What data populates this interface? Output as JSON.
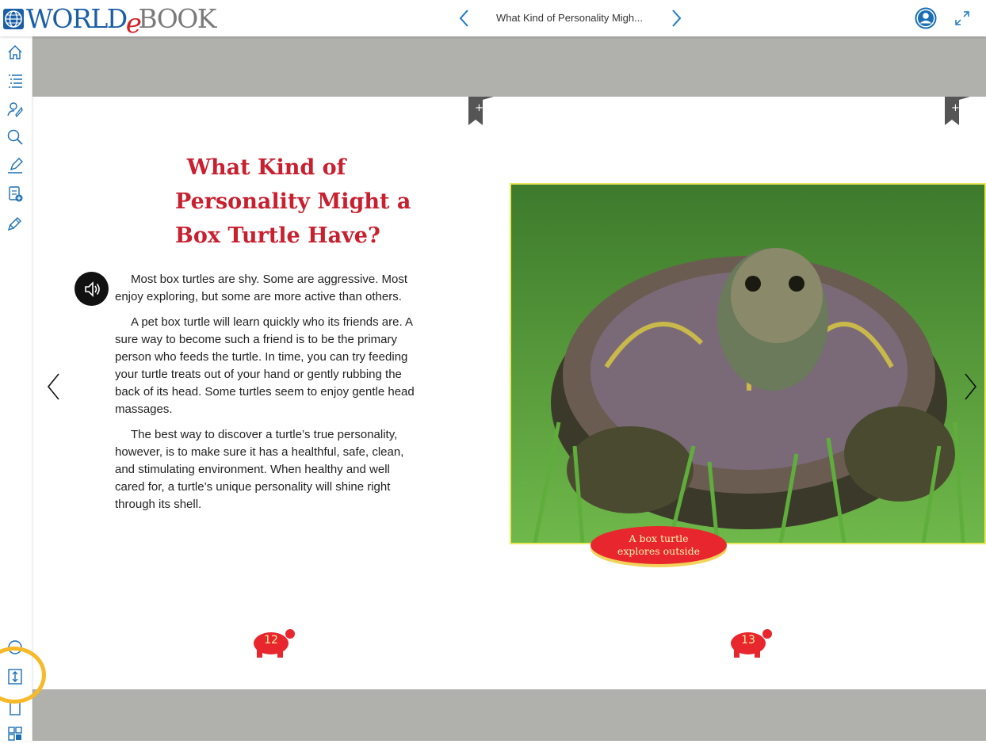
{
  "app": {
    "logo_world": "WORLD",
    "logo_e": "e",
    "logo_book": "BOOK"
  },
  "header": {
    "doc_title": "What Kind of Personality Migh..."
  },
  "page": {
    "title_lines": [
      "What Kind of",
      "Personality Might a",
      "Box Turtle Have?"
    ],
    "paragraphs": [
      "Most box turtles are shy. Some are aggressive. Most enjoy exploring, but some are more active than others.",
      "A pet box turtle will learn quickly who its friends are. A sure way to become such a friend is to be the primary person who feeds the turtle. In time, you can try feeding your turtle treats out of your hand or gently rubbing the back of its head. Some turtles seem to enjoy gentle head massages.",
      "The best way to discover a turtle’s true personality, however, is to make sure it has a healthful, safe, clean, and stimulating environment. When healthy and well cared for, a turtle’s unique personality will shine right through its shell."
    ],
    "caption_lines": [
      "A box turtle",
      "explores outside"
    ],
    "left_page_number": "12",
    "right_page_number": "13"
  },
  "sidebar": {
    "top_icons": [
      "home-icon",
      "table-of-contents-icon",
      "activities-icon",
      "search-icon",
      "notes-edit-icon",
      "add-note-icon",
      "highlighter-icon"
    ],
    "bottom_icons": [
      "help-icon",
      "scroll-mode-icon",
      "single-page-icon",
      "thumbnails-icon"
    ]
  },
  "colors": {
    "title_red": "#c8202f",
    "brand_blue": "#1a5fa6",
    "highlight_ring": "#f7b928",
    "page_gray": "#b0b0ad"
  }
}
